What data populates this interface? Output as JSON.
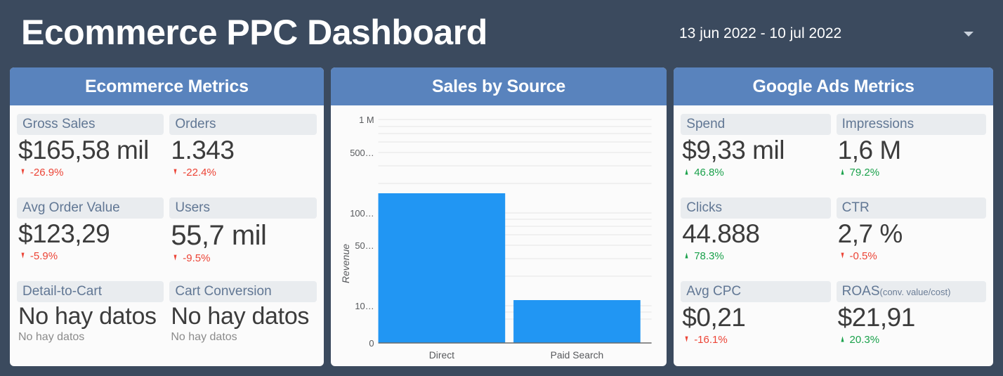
{
  "header": {
    "title": "Ecommerce PPC Dashboard",
    "date_range": "13 jun 2022 - 10 jul 2022",
    "caret_icon": "chevron-down-icon"
  },
  "colors": {
    "background": "#3b4a5e",
    "panel_header": "#5983bd",
    "panel_body": "#fbfbfb",
    "chip": "#e9ecef",
    "chip_text": "#617794",
    "value_text": "#3c3c3c",
    "positive": "#1aa14b",
    "negative": "#ec4436",
    "bar": "#2196f3"
  },
  "panels": {
    "ecommerce": {
      "title": "Ecommerce Metrics",
      "cards": [
        {
          "label": "Gross Sales",
          "sublabel": "",
          "value": "$165,58 mil",
          "delta": "-26.9%",
          "trend": "down",
          "arrow_icon": "arrow-down-icon"
        },
        {
          "label": "Orders",
          "sublabel": "",
          "value": "1.343",
          "delta": "-22.4%",
          "trend": "down",
          "arrow_icon": "arrow-down-icon"
        },
        {
          "label": "Avg Order Value",
          "sublabel": "",
          "value": "$123,29",
          "delta": "-5.9%",
          "trend": "down",
          "arrow_icon": "arrow-down-icon"
        },
        {
          "label": "Users",
          "sublabel": "",
          "value": "55,7 mil",
          "delta": "-9.5%",
          "trend": "down",
          "arrow_icon": "arrow-down-icon"
        },
        {
          "label": "Detail-to-Cart",
          "sublabel": "",
          "value": "No hay datos",
          "delta": "No hay datos",
          "trend": "none",
          "arrow_icon": ""
        },
        {
          "label": "Cart Conversion",
          "sublabel": "",
          "value": "No hay datos",
          "delta": "No hay datos",
          "trend": "none",
          "arrow_icon": ""
        }
      ]
    },
    "sales_by_source": {
      "title": "Sales by Source"
    },
    "google_ads": {
      "title": "Google Ads Metrics",
      "cards": [
        {
          "label": "Spend",
          "sublabel": "",
          "value": "$9,33 mil",
          "delta": "46.8%",
          "trend": "up",
          "arrow_icon": "arrow-up-icon"
        },
        {
          "label": "Impressions",
          "sublabel": "",
          "value": "1,6 M",
          "delta": "79.2%",
          "trend": "up",
          "arrow_icon": "arrow-up-icon"
        },
        {
          "label": "Clicks",
          "sublabel": "",
          "value": "44.888",
          "delta": "78.3%",
          "trend": "up",
          "arrow_icon": "arrow-up-icon"
        },
        {
          "label": "CTR",
          "sublabel": "",
          "value": "2,7 %",
          "delta": "-0.5%",
          "trend": "down",
          "arrow_icon": "arrow-down-icon"
        },
        {
          "label": "Avg CPC",
          "sublabel": "",
          "value": "$0,21",
          "delta": "-16.1%",
          "trend": "down",
          "arrow_icon": "arrow-down-icon"
        },
        {
          "label": "ROAS",
          "sublabel": "(conv. value/cost)",
          "value": "$21,91",
          "delta": "20.3%",
          "trend": "up",
          "arrow_icon": "arrow-up-icon"
        }
      ]
    }
  },
  "chart_data": {
    "type": "bar",
    "title": "Sales by Source",
    "xlabel": "",
    "ylabel": "Revenue",
    "yscale": "log",
    "categories": [
      "Direct",
      "Paid Search"
    ],
    "values": [
      150000,
      7000
    ],
    "series": [
      {
        "name": "Revenue",
        "values": [
          150000,
          7000
        ]
      }
    ],
    "ytick_labels": [
      "1 M",
      "500…",
      "100…",
      "50…",
      "10…",
      "0"
    ],
    "ytick_values": [
      1000000,
      500000,
      100000,
      50000,
      10000,
      0
    ],
    "ylim": [
      0,
      1000000
    ],
    "grid": true,
    "legend": "none",
    "bar_color": "#2196f3"
  }
}
